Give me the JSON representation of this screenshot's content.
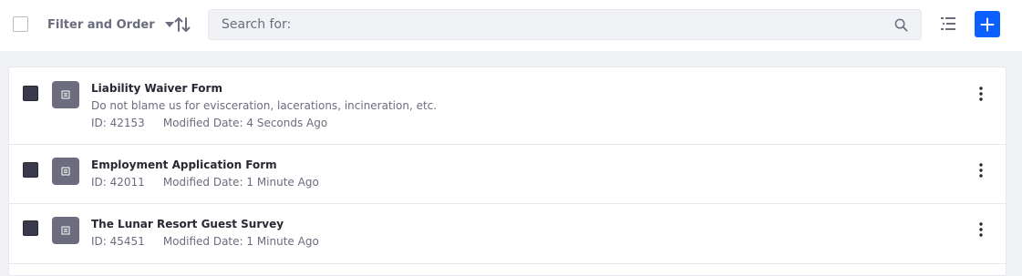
{
  "toolbar": {
    "filter_label": "Filter and Order",
    "search_placeholder": "Search for:",
    "search_value": "",
    "icons": {
      "select_all": "checkbox-icon",
      "filter_caret": "caret-down-icon",
      "sort": "order-arrow-icon",
      "search": "search-icon",
      "view": "list-view-icon",
      "add": "plus-icon"
    }
  },
  "records": [
    {
      "title": "Liability Waiver Form",
      "description": "Do not blame us for evisceration, lacerations, incineration, etc.",
      "id_text": "ID: 42153",
      "modified_text": "Modified Date: 4 Seconds Ago",
      "checked": true,
      "icon": "form-icon"
    },
    {
      "title": "Employment Application Form",
      "description": "",
      "id_text": "ID: 42011",
      "modified_text": "Modified Date: 1 Minute Ago",
      "checked": true,
      "icon": "form-icon"
    },
    {
      "title": "The Lunar Resort Guest Survey",
      "description": "",
      "id_text": "ID: 45451",
      "modified_text": "Modified Date: 1 Minute Ago",
      "checked": true,
      "icon": "form-icon"
    }
  ],
  "colors": {
    "accent": "#0b5fff",
    "page_background": "#f1f2f5",
    "tile": "#6b6c7e",
    "text_secondary": "#6b6c7e"
  }
}
